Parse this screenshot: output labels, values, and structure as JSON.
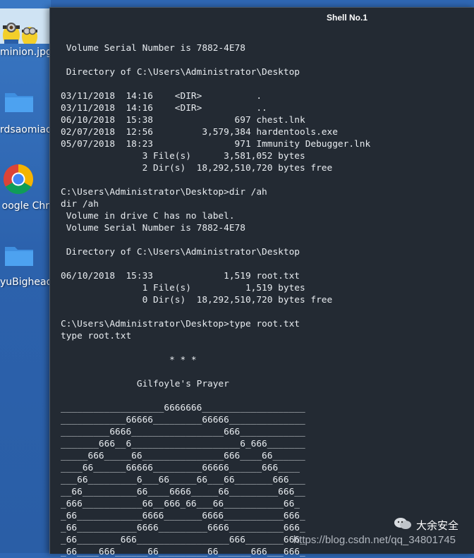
{
  "desktop": {
    "icons": [
      {
        "label": "minion.jpg",
        "icon": "image-thumbnail-icon"
      },
      {
        "label": "rdsaomiao",
        "icon": "folder-icon"
      },
      {
        "label": "oogle Chr",
        "icon": "chrome-icon"
      },
      {
        "label": "yuBighead",
        "icon": "folder-icon"
      }
    ]
  },
  "window": {
    "title": "Shell No.1"
  },
  "terminal": {
    "lines": [
      "",
      " Volume Serial Number is 7882-4E78",
      "",
      " Directory of C:\\Users\\Administrator\\Desktop",
      "",
      "03/11/2018  14:16    <DIR>          .",
      "03/11/2018  14:16    <DIR>          ..",
      "06/10/2018  15:38               697 chest.lnk",
      "02/07/2018  12:56         3,579,384 hardentools.exe",
      "05/07/2018  18:23               971 Immunity Debugger.lnk",
      "               3 File(s)      3,581,052 bytes",
      "               2 Dir(s)  18,292,510,720 bytes free",
      "",
      "C:\\Users\\Administrator\\Desktop>dir /ah",
      "dir /ah",
      " Volume in drive C has no label.",
      " Volume Serial Number is 7882-4E78",
      "",
      " Directory of C:\\Users\\Administrator\\Desktop",
      "",
      "06/10/2018  15:33             1,519 root.txt",
      "               1 File(s)          1,519 bytes",
      "               0 Dir(s)  18,292,510,720 bytes free",
      "",
      "C:\\Users\\Administrator\\Desktop>type root.txt",
      "type root.txt",
      "",
      "                    * * *",
      "",
      "              Gilfoyle's Prayer",
      "",
      "___________________6666666___________________",
      "____________66666_________66666______________",
      "_________6666_________________666____________",
      "_______666__6____________________6_666_______",
      "_____666_____66_______________666____66______",
      "____66______66666_________66666______666____",
      "___66_________6___66_____66___66_______666___",
      "__66__________66____6666_____66_________666__",
      "_666___________66__666_66___66___________66_",
      "_66____________6666_______6666___________666_",
      "_66___________6666_________6666__________666_",
      "_66________666_________________666_______666_",
      "_66____666______66_________66______666___666_"
    ]
  },
  "watermark": {
    "url": "https://blog.csdn.net/qq_34801745",
    "brand": "大余安全"
  }
}
